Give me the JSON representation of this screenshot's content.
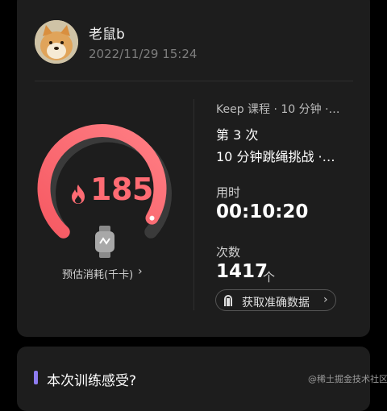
{
  "user": {
    "name": "老鼠b",
    "datetime": "2022/11/29 15:24"
  },
  "calories": {
    "value": "185",
    "label": "预估消耗(千卡)",
    "chevron": "›",
    "flame_icon": "flame-icon",
    "watch_icon": "smartwatch-icon",
    "accent_color": "#ff6b73"
  },
  "workout": {
    "course": "Keep 课程 · 10 分钟 ·…",
    "times": "第 3 次",
    "challenge": "10 分钟跳绳挑战 ·…",
    "duration_label": "用时",
    "duration_value": "00:10:20",
    "count_label": "次数",
    "count_value": "1417",
    "count_unit": "个",
    "accurate_data_label": "获取准确数据",
    "accurate_data_chevron": "›"
  },
  "feeling": {
    "title": "本次训练感受?",
    "accent_color": "#8e7cf0"
  },
  "watermark": "@稀土掘金技术社区"
}
